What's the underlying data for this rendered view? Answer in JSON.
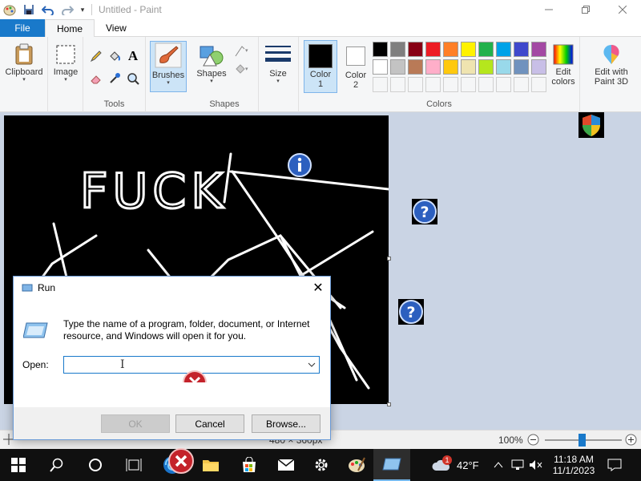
{
  "window": {
    "title": "Untitled - Paint"
  },
  "tabs": [
    "File",
    "Home",
    "View"
  ],
  "ribbon": {
    "clipboard_label": "Clipboard",
    "image_label": "Image",
    "tools_group": "Tools",
    "brushes_label": "Brushes",
    "shapes_label": "Shapes",
    "shapes_group": "Shapes",
    "size_label": "Size",
    "color1_label": "Color",
    "color1_num": "1",
    "color2_label": "Color",
    "color2_num": "2",
    "colors_group": "Colors",
    "edit_colors_line1": "Edit",
    "edit_colors_line2": "colors",
    "paint3d_line1": "Edit with",
    "paint3d_line2": "Paint 3D"
  },
  "palette": {
    "row1": [
      "#000000",
      "#7f7f7f",
      "#880015",
      "#ed1c24",
      "#ff7f27",
      "#fff200",
      "#22b14c",
      "#00a2e8",
      "#3f48cc",
      "#a349a4"
    ],
    "row2": [
      "#ffffff",
      "#c3c3c3",
      "#b97a57",
      "#ffaec9",
      "#ffc90e",
      "#efe4b0",
      "#b5e61d",
      "#99d9ea",
      "#7092be",
      "#c8bfe7"
    ]
  },
  "canvas": {
    "drawn_text": "FUCK"
  },
  "statusbar": {
    "size": "480 × 360px",
    "zoom": "100%"
  },
  "run_dialog": {
    "title": "Run",
    "description": "Type the name of a program, folder, document, or Internet resource, and Windows will open it for you.",
    "open_label": "Open:",
    "open_value": "",
    "ok": "OK",
    "cancel": "Cancel",
    "browse": "Browse..."
  },
  "taskbar": {
    "weather": "42°F",
    "weather_badge": "1",
    "time": "11:18 AM",
    "date": "11/1/2023"
  }
}
